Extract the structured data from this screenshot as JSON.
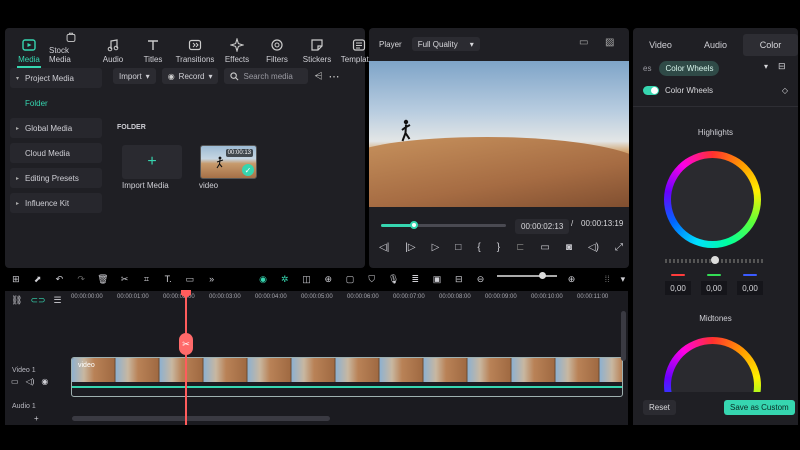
{
  "nav": {
    "tabs": [
      {
        "label": "Media",
        "icon": "media-icon"
      },
      {
        "label": "Stock Media",
        "icon": "stock-media-icon"
      },
      {
        "label": "Audio",
        "icon": "music-note-icon"
      },
      {
        "label": "Titles",
        "icon": "text-icon"
      },
      {
        "label": "Transitions",
        "icon": "transitions-icon"
      },
      {
        "label": "Effects",
        "icon": "sparkle-icon"
      },
      {
        "label": "Filters",
        "icon": "filters-icon"
      },
      {
        "label": "Stickers",
        "icon": "sticker-icon"
      },
      {
        "label": "Templates",
        "icon": "templates-icon"
      }
    ]
  },
  "sidebar": {
    "items": [
      {
        "label": "Project Media"
      },
      {
        "label": "Folder"
      },
      {
        "label": "Global Media"
      },
      {
        "label": "Cloud Media"
      },
      {
        "label": "Editing Presets"
      },
      {
        "label": "Influence Kit"
      }
    ]
  },
  "media": {
    "import_label": "Import",
    "record_label": "Record",
    "search_placeholder": "Search media",
    "folder_label": "FOLDER",
    "import_media_label": "Import Media",
    "video_label": "video",
    "video_duration": "00:00:13"
  },
  "player": {
    "label": "Player",
    "quality": "Full Quality",
    "current_time": "00:00:02:13",
    "separator": "/",
    "total_time": "00:00:13:19"
  },
  "right": {
    "tabs": [
      "Video",
      "Audio",
      "Color"
    ],
    "active_tab": "Color",
    "subtab_prev": "es",
    "subtab_active": "Color Wheels",
    "section_title": "Color Wheels",
    "highlights_label": "Highlights",
    "midtones_label": "Midtones",
    "rgb_values": [
      "0,00",
      "0,00",
      "0,00"
    ],
    "rgb_colors": [
      "#ff3b3b",
      "#33dd55",
      "#3b5bff"
    ],
    "reset_label": "Reset",
    "save_label": "Save as Custom"
  },
  "timeline": {
    "ticks": [
      "00:00:00:00",
      "00:00:01:00",
      "00:00:02:00",
      "00:00:03:00",
      "00:00:04:00",
      "00:00:05:00",
      "00:00:06:00",
      "00:00:07:00",
      "00:00:08:00",
      "00:00:09:00",
      "00:00:10:00",
      "00:00:11:00"
    ],
    "video_track_label": "Video 1",
    "audio_track_label": "Audio 1",
    "clip_name": "video"
  },
  "colors": {
    "accent": "#36d6b0",
    "playhead": "#ff5c5c"
  }
}
